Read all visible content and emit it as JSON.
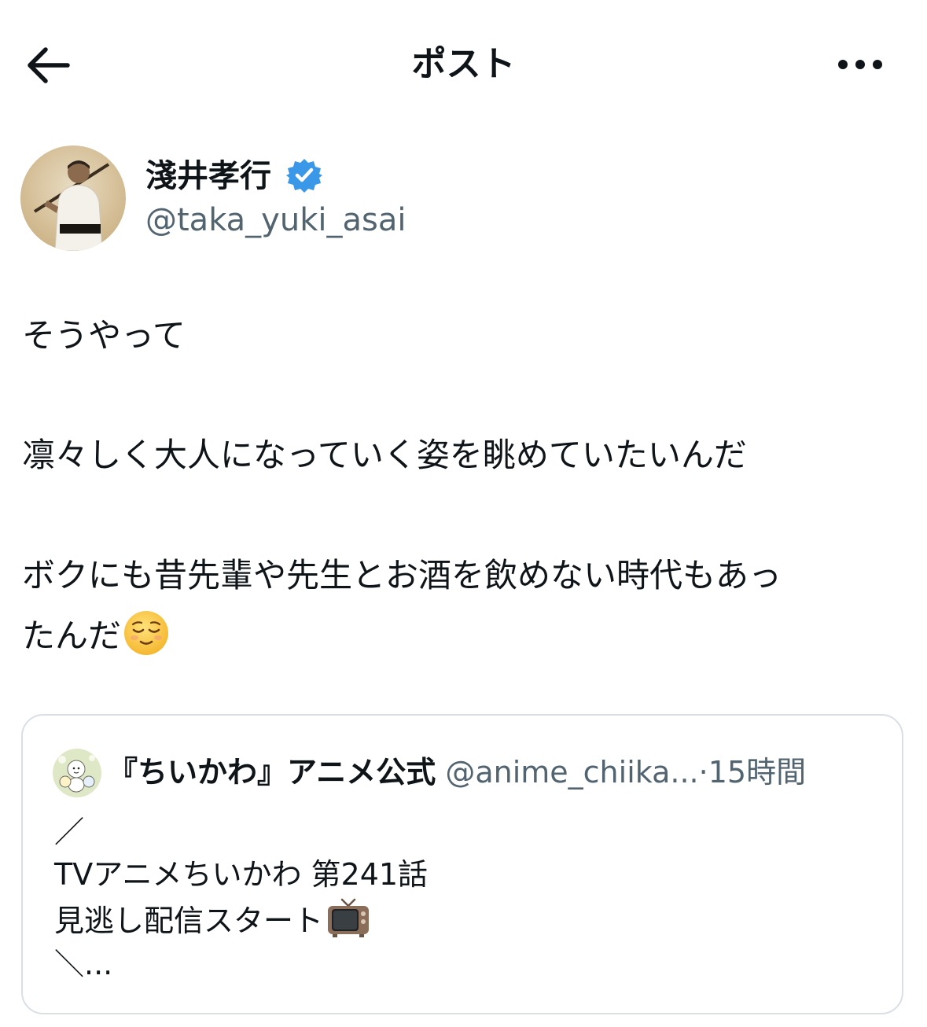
{
  "header": {
    "title": "ポスト",
    "back_icon": "arrow-left-icon",
    "more_icon": "more-dots-icon"
  },
  "author": {
    "display_name": "淺井孝行",
    "handle": "@taka_yuki_asai",
    "verified": true,
    "verified_color": "#3b97e8"
  },
  "post": {
    "lines": [
      "そうやって",
      "凛々しく大人になっていく姿を眺めていたいんだ",
      "ボクにも昔先輩や先生とお酒を飲めない時代もあっ",
      "たんだ"
    ],
    "emoji": "relieved-face"
  },
  "quote": {
    "name": "『ちいかわ』アニメ公式",
    "handle": "@anime_chiika...",
    "separator": "·",
    "time": "15時間",
    "lines": [
      "／",
      " TVアニメちいかわ 第241話",
      "見逃し配信スタート",
      "＼..."
    ],
    "tv_emoji": "television-icon"
  },
  "colors": {
    "text": "#0f1419",
    "secondary": "#536471",
    "border": "#d9dfe4"
  }
}
